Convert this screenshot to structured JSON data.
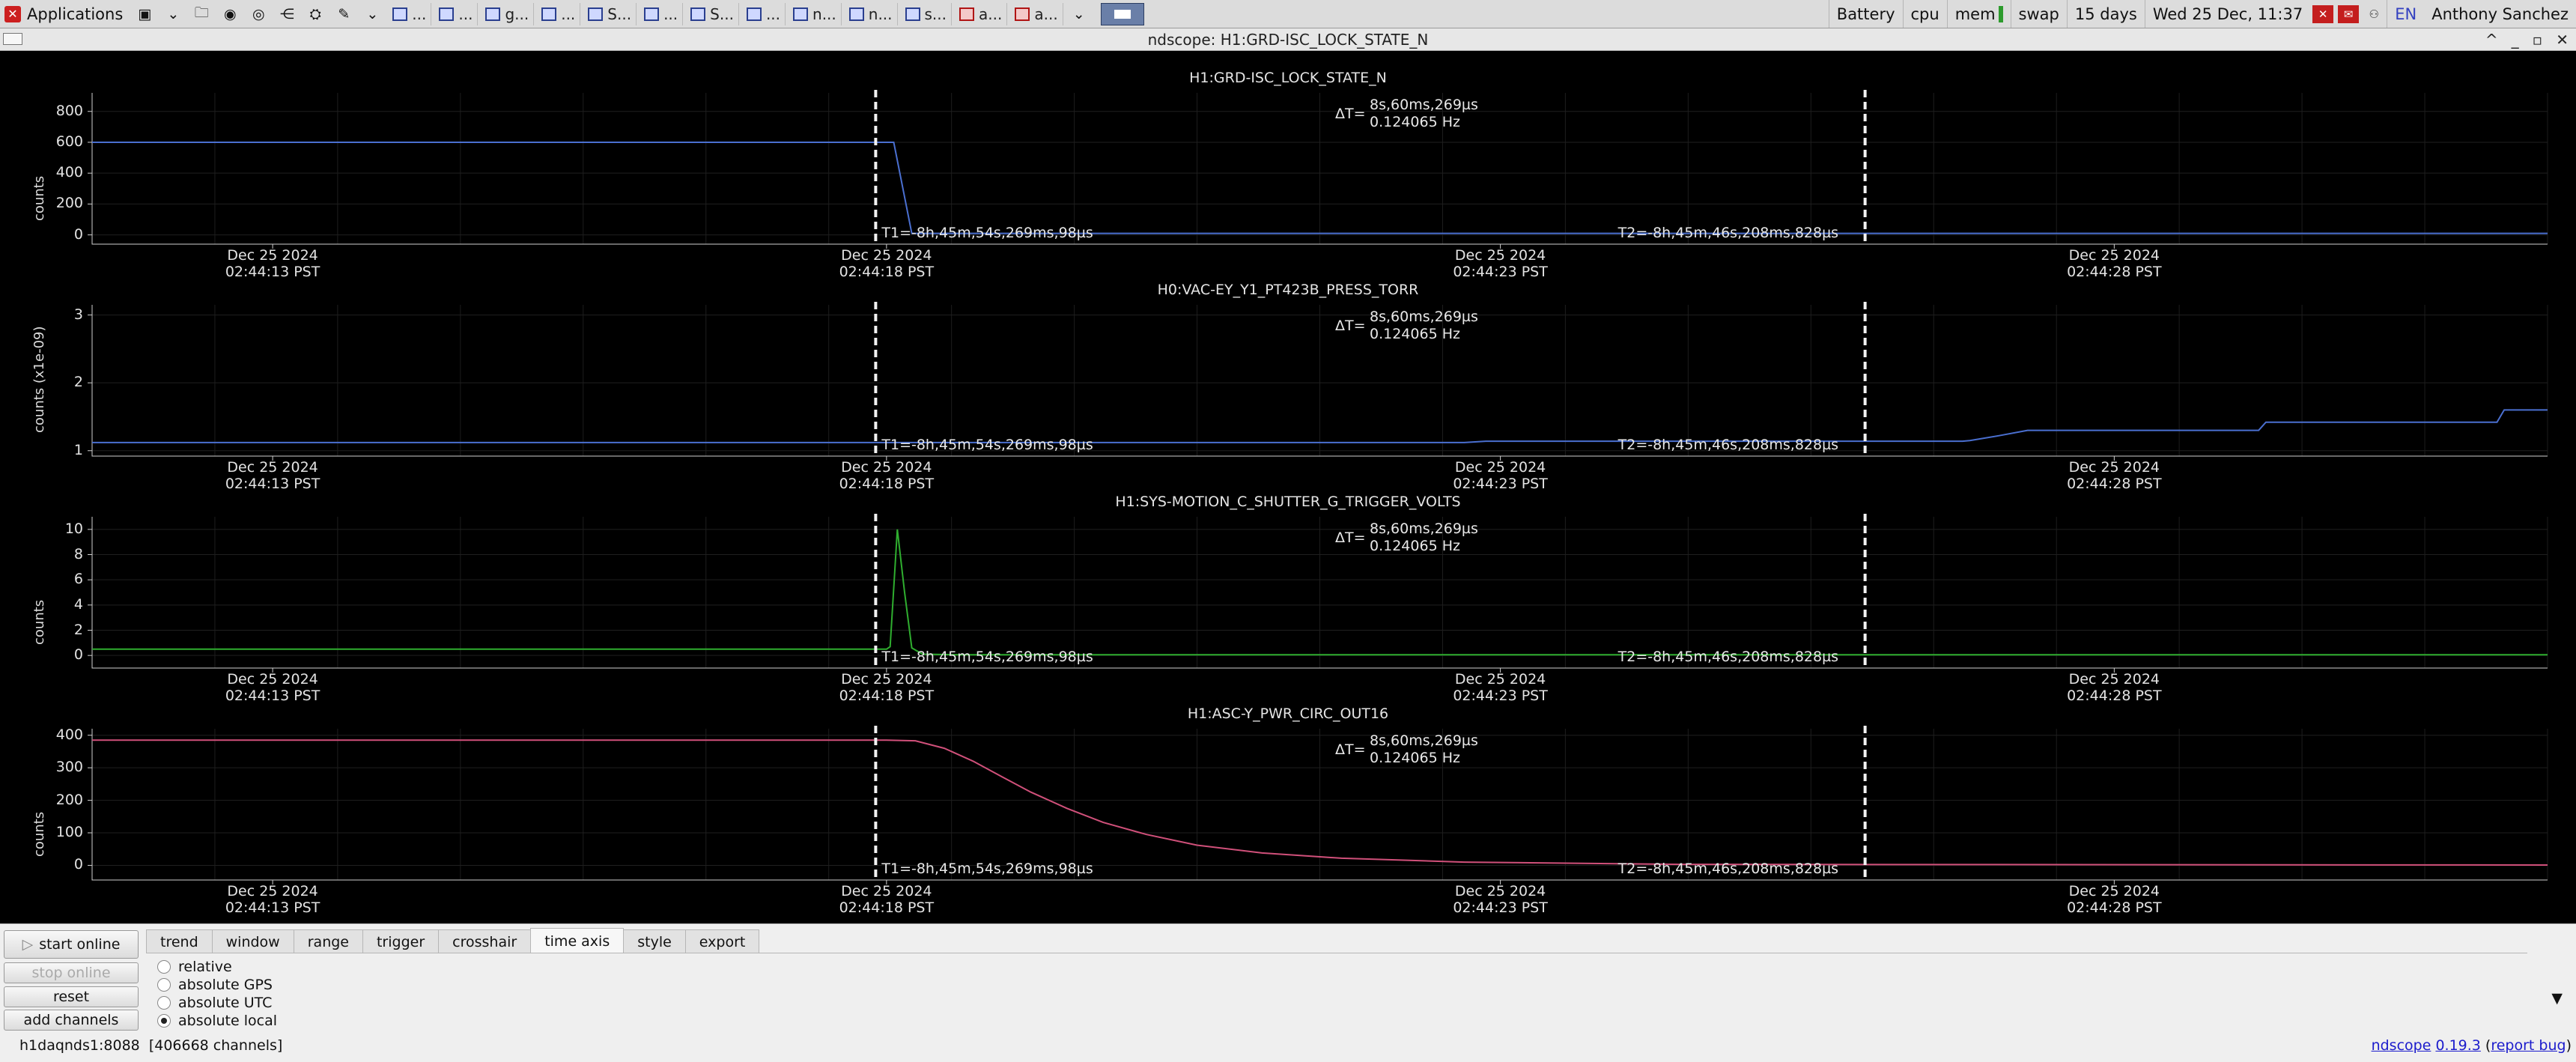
{
  "taskbar": {
    "apps_label": "Applications",
    "tasks": [
      {
        "label": "...",
        "icon": "terminal-icon"
      },
      {
        "label": "...",
        "icon": "firefox-icon"
      },
      {
        "label": "g...",
        "icon": "x-icon"
      },
      {
        "label": "...",
        "icon": "window-icon"
      },
      {
        "label": "S...",
        "icon": "window-icon"
      },
      {
        "label": "...",
        "icon": "window-icon"
      },
      {
        "label": "S...",
        "icon": "window-icon"
      },
      {
        "label": "...",
        "icon": "window-icon"
      },
      {
        "label": "n...",
        "icon": "window-icon"
      },
      {
        "label": "n...",
        "icon": "window-icon"
      },
      {
        "label": "s...",
        "icon": "chrome-icon"
      },
      {
        "label": "a...",
        "icon": "pdf-icon"
      },
      {
        "label": "a...",
        "icon": "pdf-icon"
      }
    ],
    "battery": "Battery",
    "cpu": "cpu",
    "mem": "mem",
    "swap": "swap",
    "uptime": "15 days",
    "clock": "Wed 25 Dec, 11:37",
    "lang": "EN",
    "user": "Anthony Sanchez"
  },
  "window": {
    "title": "ndscope: H1:GRD-ISC_LOCK_STATE_N",
    "controls": [
      "^",
      "_",
      "▫",
      "✕"
    ]
  },
  "cursors": {
    "t1_label": "T1=-8h,45m,54s,269ms,98µs",
    "t2_label": "T2=-8h,45m,46s,208ms,828µs",
    "delta_symbol": "ΔT=",
    "delta_time": "8s,60ms,269µs",
    "delta_freq": "0.124065 Hz"
  },
  "x_ticks": [
    {
      "date": "Dec 25 2024",
      "time": "02:44:13 PST"
    },
    {
      "date": "Dec 25 2024",
      "time": "02:44:18 PST"
    },
    {
      "date": "Dec 25 2024",
      "time": "02:44:23 PST"
    },
    {
      "date": "Dec 25 2024",
      "time": "02:44:28 PST"
    }
  ],
  "chart_data": [
    {
      "type": "line",
      "title": "H1:GRD-ISC_LOCK_STATE_N",
      "ylabel": "counts",
      "yticks": [
        "800",
        "600",
        "400",
        "200",
        "0"
      ],
      "ylim": [
        -60,
        920
      ],
      "color": "#4a6fd0",
      "x": [
        0,
        10.2,
        11.1,
        11.35,
        14.0,
        22.0,
        34.0
      ],
      "y": [
        600,
        600,
        600,
        10,
        10,
        10,
        10
      ]
    },
    {
      "type": "line",
      "title": "H0:VAC-EY_Y1_PT423B_PRESS_TORR",
      "ylabel": "counts (x1e-09)",
      "yticks": [
        "3",
        "2",
        "1"
      ],
      "ylim": [
        0.92,
        3.15
      ],
      "color": "#4a6fd0",
      "x": [
        0,
        10.0,
        11.0,
        19.0,
        19.3,
        25.9,
        26.0,
        26.4,
        26.8,
        30.0,
        30.1,
        33.3,
        33.4,
        34.0
      ],
      "y": [
        1.12,
        1.12,
        1.12,
        1.12,
        1.14,
        1.14,
        1.15,
        1.22,
        1.3,
        1.3,
        1.42,
        1.42,
        1.6,
        1.6
      ]
    },
    {
      "type": "line",
      "title": "H1:SYS-MOTION_C_SHUTTER_G_TRIGGER_VOLTS",
      "ylabel": "counts",
      "yticks": [
        "10",
        "8",
        "6",
        "4",
        "2",
        "0"
      ],
      "ylim": [
        -1.0,
        11.0
      ],
      "color": "#2fae2f",
      "x": [
        0,
        11.0,
        11.05,
        11.15,
        11.25,
        11.35,
        11.5,
        12.0,
        34.0
      ],
      "y": [
        0.5,
        0.5,
        0.7,
        10,
        5,
        0.6,
        0.1,
        0.05,
        0.05
      ]
    },
    {
      "type": "line",
      "title": "H1:ASC-Y_PWR_CIRC_OUT16",
      "ylabel": "counts",
      "yticks": [
        "400",
        "300",
        "200",
        "100",
        "0"
      ],
      "ylim": [
        -45,
        420
      ],
      "color": "#d0507a",
      "x": [
        0,
        11.0,
        11.4,
        11.8,
        12.2,
        12.6,
        13.0,
        13.5,
        14.0,
        14.6,
        15.3,
        16.2,
        17.3,
        19.0,
        22.0,
        34.0
      ],
      "y": [
        385,
        385,
        383,
        360,
        320,
        272,
        225,
        175,
        132,
        95,
        62,
        38,
        22,
        10,
        3,
        1
      ]
    }
  ],
  "controls": {
    "start_online": "start online",
    "stop_online": "stop online",
    "reset": "reset",
    "add_channels": "add channels",
    "tabs": [
      "trend",
      "window",
      "range",
      "trigger",
      "crosshair",
      "time axis",
      "style",
      "export"
    ],
    "active_tab": "time axis",
    "radio_options": [
      "relative",
      "absolute GPS",
      "absolute UTC",
      "absolute local"
    ],
    "radio_selected": "absolute local",
    "status": "h1daqnds1:8088  [406668 channels]",
    "version_name": "ndscope",
    "version": "0.19.3",
    "report_bug": "report bug"
  }
}
